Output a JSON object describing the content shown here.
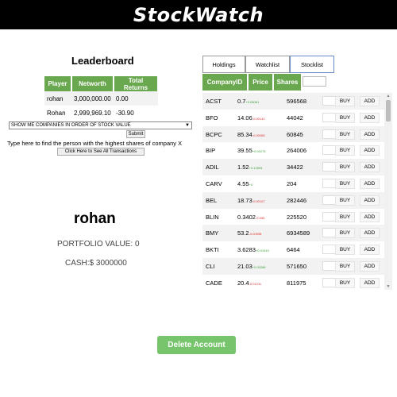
{
  "app": {
    "title": "StockWatch"
  },
  "leaderboard": {
    "title": "Leaderboard",
    "headers": [
      "Player",
      "Networth",
      "Total Returns"
    ],
    "rows": [
      {
        "player": "rohan",
        "networth": "3,000,000.00",
        "returns": "0.00"
      },
      {
        "player": "Rohan",
        "networth": "2,999,969.10",
        "returns": "-30.90"
      }
    ]
  },
  "query": {
    "selected": "SHOW ME COMPANIES IN ORDER OF STOCK VALUE",
    "submit_label": "Submit",
    "hint": "Type here to find the person with the highest shares of company X",
    "transactions_label": "Click Here to See All Transactions"
  },
  "user": {
    "name": "rohan",
    "portfolio": "PORTFOLIO VALUE: 0",
    "cash": "CASH:$ 3000000"
  },
  "tabs": [
    "Holdings",
    "Watchlist",
    "Stocklist"
  ],
  "stock_headers": [
    "CompanyID",
    "Price",
    "Shares"
  ],
  "buttons": {
    "buy": "BUY",
    "add": "ADD"
  },
  "stocks": [
    {
      "sym": "ACST",
      "price": "0.7",
      "chg": "+0.06061",
      "dir": "up",
      "shares": "596568"
    },
    {
      "sym": "BFO",
      "price": "14.06",
      "chg": "-0.00142",
      "dir": "down",
      "shares": "44042"
    },
    {
      "sym": "BCPC",
      "price": "85.34",
      "chg": "-0.00085",
      "dir": "down",
      "shares": "60845"
    },
    {
      "sym": "BIP",
      "price": "39.55",
      "chg": "+0.02276",
      "dir": "up",
      "shares": "264006"
    },
    {
      "sym": "ADIL",
      "price": "1.52",
      "chg": "+0.12593",
      "dir": "up",
      "shares": "34422"
    },
    {
      "sym": "CARV",
      "price": "4.55",
      "chg": "+0",
      "dir": "up",
      "shares": "204"
    },
    {
      "sym": "BEL",
      "price": "18.73",
      "chg": "-0.00107",
      "dir": "down",
      "shares": "282446"
    },
    {
      "sym": "BLIN",
      "price": "0.3402",
      "chg": "-0.055",
      "dir": "down",
      "shares": "225520"
    },
    {
      "sym": "BMY",
      "price": "53.2",
      "chg": "-0.00598",
      "dir": "down",
      "shares": "6934589"
    },
    {
      "sym": "BKTI",
      "price": "3.6283",
      "chg": "+0.01919",
      "dir": "up",
      "shares": "6464"
    },
    {
      "sym": "CLI",
      "price": "21.03",
      "chg": "+0.00286",
      "dir": "up",
      "shares": "571650"
    },
    {
      "sym": "CADE",
      "price": "20.4",
      "chg": "-0.01211",
      "dir": "down",
      "shares": "811975"
    }
  ],
  "delete_label": "Delete Account"
}
